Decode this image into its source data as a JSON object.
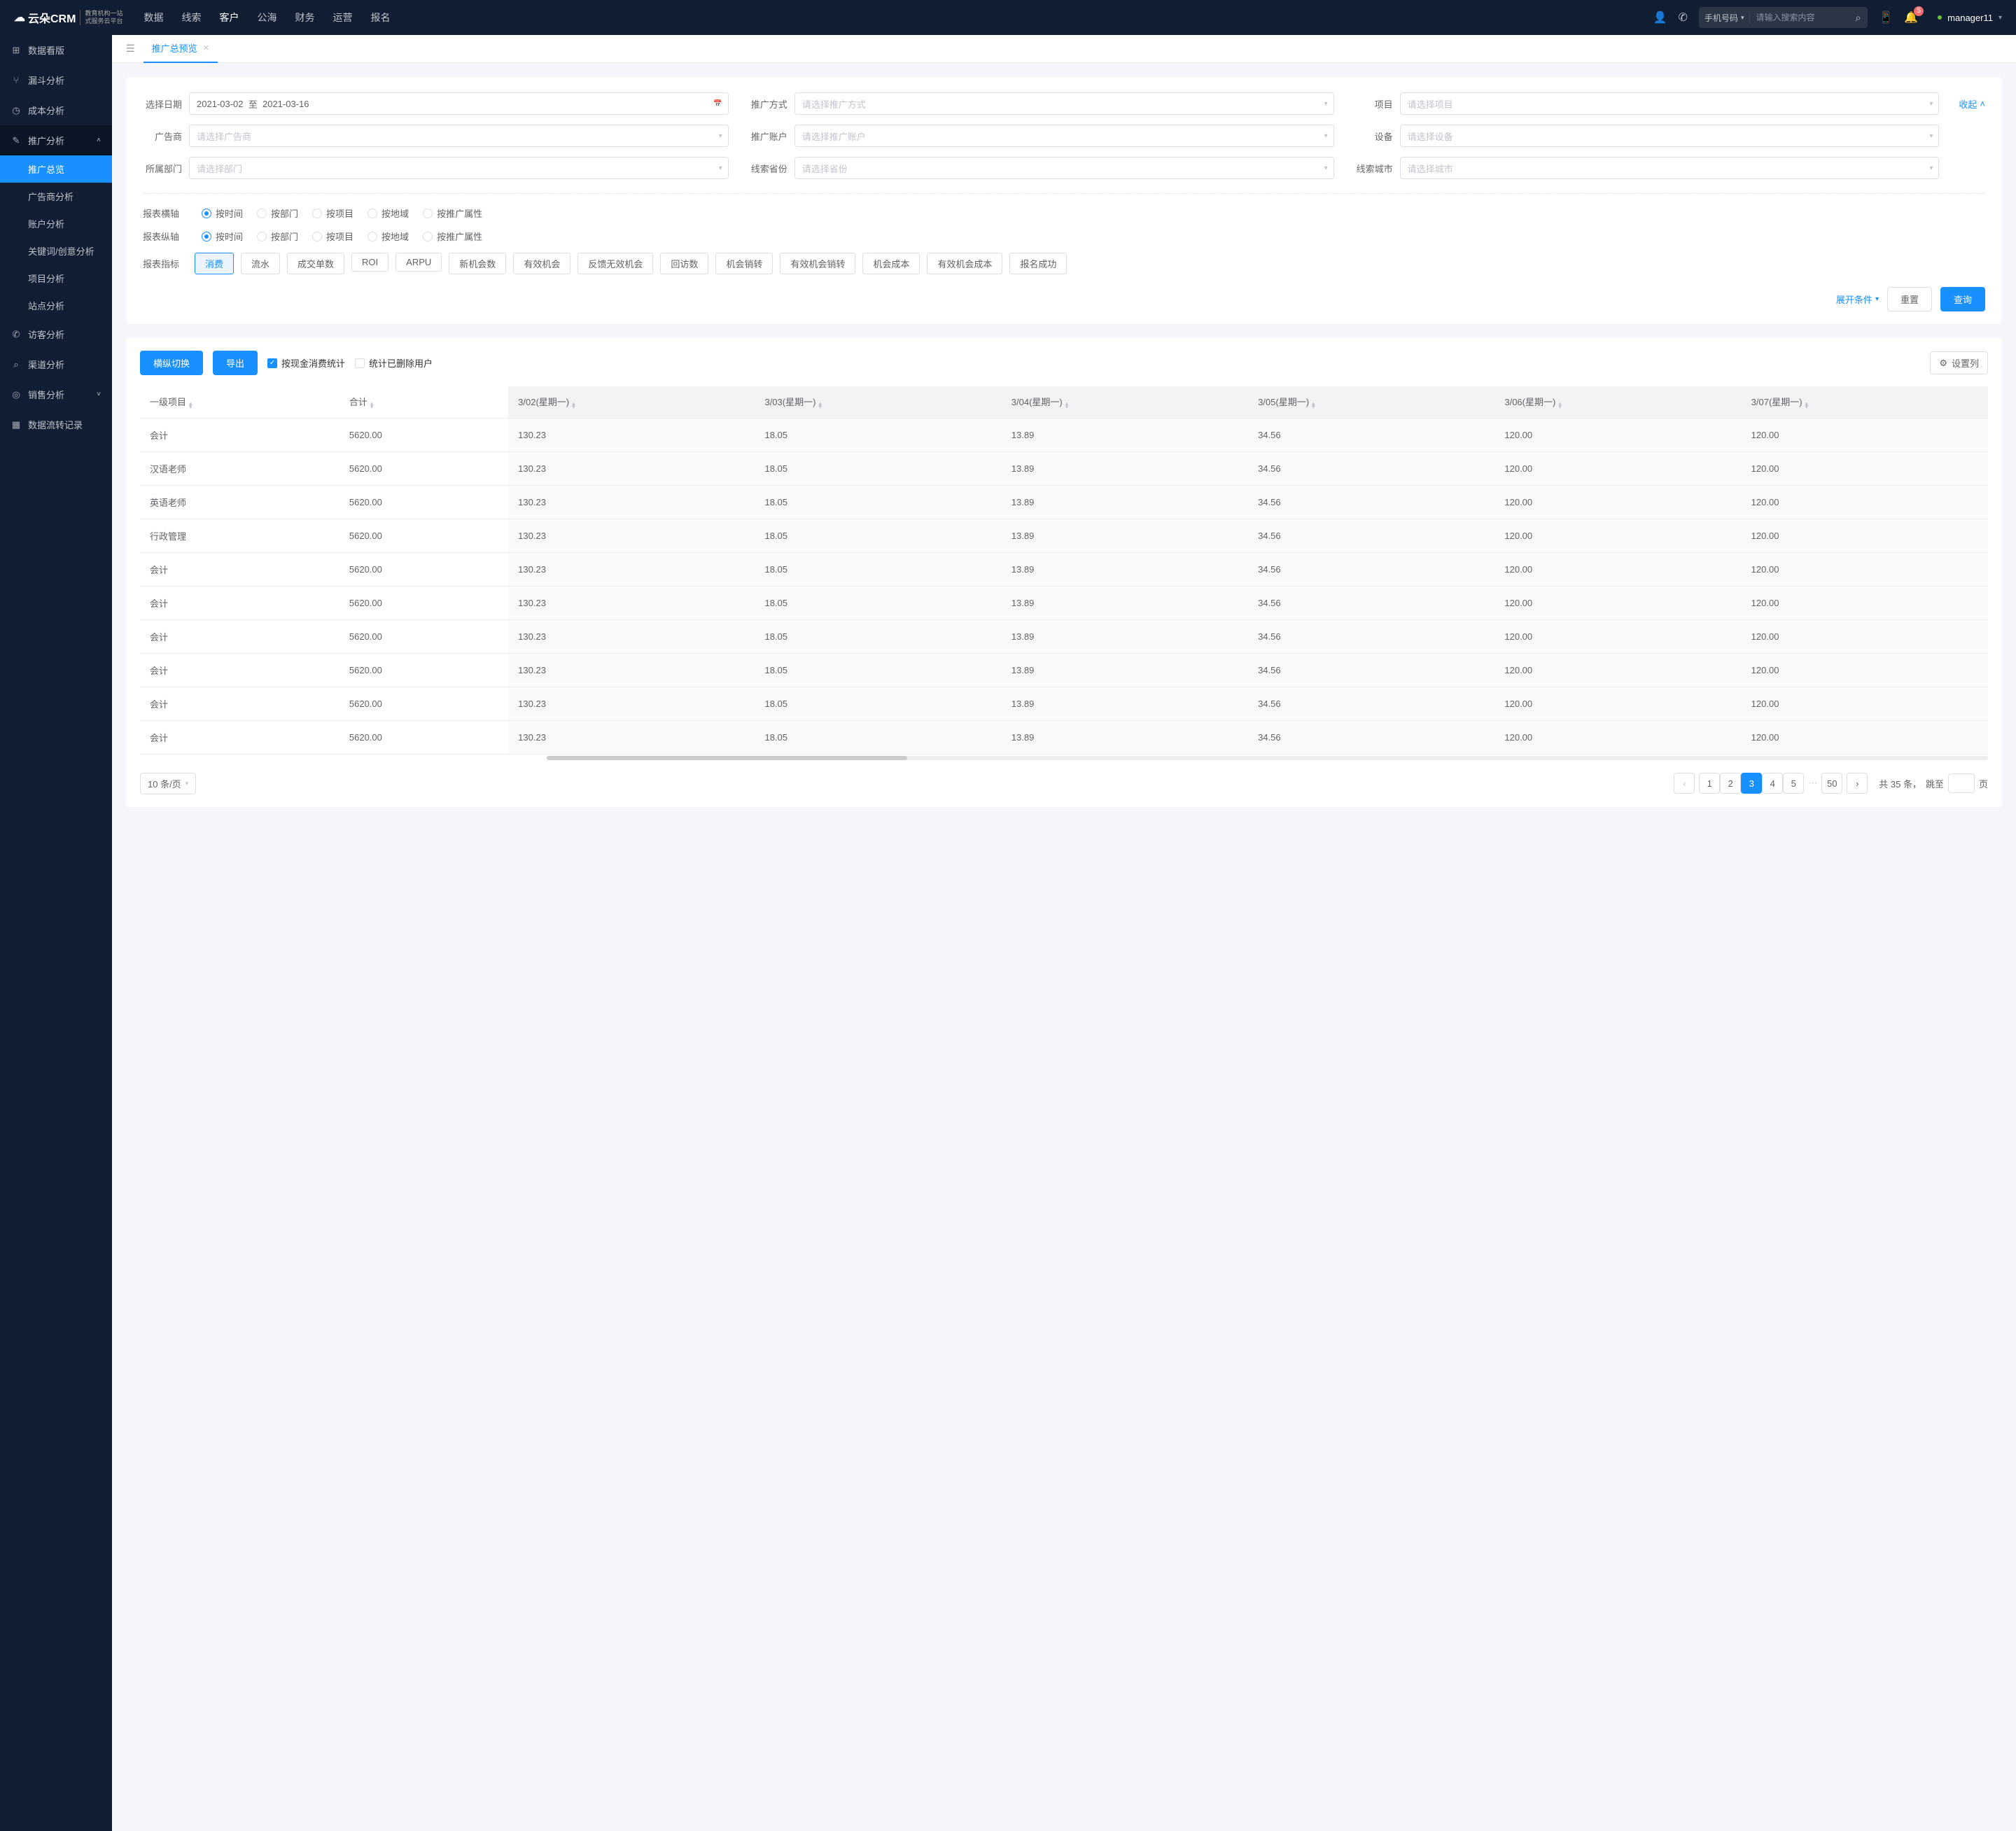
{
  "brand": {
    "name": "云朵CRM",
    "url": "www.yunduocrm.com",
    "tag1": "教育机构一站",
    "tag2": "式服务云平台"
  },
  "topnav": [
    "数据",
    "线索",
    "客户",
    "公海",
    "财务",
    "运营",
    "报名"
  ],
  "topnav_active": 2,
  "search": {
    "type": "手机号码",
    "placeholder": "请输入搜索内容"
  },
  "notif_count": "5",
  "user": "manager11",
  "sidebar": {
    "items": [
      {
        "icon": "⊞",
        "label": "数据看版"
      },
      {
        "icon": "⑂",
        "label": "漏斗分析"
      },
      {
        "icon": "◷",
        "label": "成本分析"
      },
      {
        "icon": "✎",
        "label": "推广分析",
        "expanded": true,
        "children": [
          "推广总览",
          "广告商分析",
          "账户分析",
          "关键词/创意分析",
          "项目分析",
          "站点分析"
        ],
        "active_child": 0
      },
      {
        "icon": "✆",
        "label": "访客分析"
      },
      {
        "icon": "⌕",
        "label": "渠道分析"
      },
      {
        "icon": "◎",
        "label": "销售分析",
        "chev": true
      },
      {
        "icon": "▦",
        "label": "数据流转记录"
      }
    ]
  },
  "tab": {
    "title": "推广总预览"
  },
  "filters": {
    "date_label": "选择日期",
    "date_from": "2021-03-02",
    "date_sep": "至",
    "date_to": "2021-03-16",
    "promo_method_label": "推广方式",
    "promo_method_ph": "请选择推广方式",
    "project_label": "项目",
    "project_ph": "请选择项目",
    "collapse": "收起",
    "advertiser_label": "广告商",
    "advertiser_ph": "请选择广告商",
    "account_label": "推广账户",
    "account_ph": "请选择推广账户",
    "device_label": "设备",
    "device_ph": "请选择设备",
    "dept_label": "所属部门",
    "dept_ph": "请选择部门",
    "province_label": "线索省份",
    "province_ph": "请选择省份",
    "city_label": "线索城市",
    "city_ph": "请选择城市"
  },
  "axis": {
    "x_label": "报表横轴",
    "y_label": "报表纵轴",
    "options": [
      "按时间",
      "按部门",
      "按项目",
      "按地域",
      "按推广属性"
    ],
    "x_selected": 0,
    "y_selected": 0
  },
  "metrics": {
    "label": "报表指标",
    "options": [
      "消费",
      "流水",
      "成交单数",
      "ROI",
      "ARPU",
      "新机会数",
      "有效机会",
      "反馈无效机会",
      "回访数",
      "机会销转",
      "有效机会销转",
      "机会成本",
      "有效机会成本",
      "报名成功"
    ],
    "selected": 0
  },
  "actions": {
    "expand": "展开条件",
    "reset": "重置",
    "query": "查询"
  },
  "tools": {
    "switch": "横纵切换",
    "export": "导出",
    "cash_cb": "按现金消费统计",
    "deleted_cb": "统计已删除用户",
    "cols": "设置列"
  },
  "table": {
    "headers": [
      "一级项目",
      "合计",
      "3/02(星期一)",
      "3/03(星期一)",
      "3/04(星期一)",
      "3/05(星期一)",
      "3/06(星期一)",
      "3/07(星期一)"
    ],
    "rows": [
      [
        "会计",
        "5620.00",
        "130.23",
        "18.05",
        "13.89",
        "34.56",
        "120.00",
        "120.00"
      ],
      [
        "汉语老师",
        "5620.00",
        "130.23",
        "18.05",
        "13.89",
        "34.56",
        "120.00",
        "120.00"
      ],
      [
        "英语老师",
        "5620.00",
        "130.23",
        "18.05",
        "13.89",
        "34.56",
        "120.00",
        "120.00"
      ],
      [
        "行政管理",
        "5620.00",
        "130.23",
        "18.05",
        "13.89",
        "34.56",
        "120.00",
        "120.00"
      ],
      [
        "会计",
        "5620.00",
        "130.23",
        "18.05",
        "13.89",
        "34.56",
        "120.00",
        "120.00"
      ],
      [
        "会计",
        "5620.00",
        "130.23",
        "18.05",
        "13.89",
        "34.56",
        "120.00",
        "120.00"
      ],
      [
        "会计",
        "5620.00",
        "130.23",
        "18.05",
        "13.89",
        "34.56",
        "120.00",
        "120.00"
      ],
      [
        "会计",
        "5620.00",
        "130.23",
        "18.05",
        "13.89",
        "34.56",
        "120.00",
        "120.00"
      ],
      [
        "会计",
        "5620.00",
        "130.23",
        "18.05",
        "13.89",
        "34.56",
        "120.00",
        "120.00"
      ],
      [
        "会计",
        "5620.00",
        "130.23",
        "18.05",
        "13.89",
        "34.56",
        "120.00",
        "120.00"
      ]
    ]
  },
  "pager": {
    "size": "10 条/页",
    "pages": [
      "1",
      "2",
      "3",
      "4",
      "5"
    ],
    "last": "50",
    "active": 2,
    "total_prefix": "共 ",
    "total": "35",
    "total_suffix": " 条，",
    "jump": "跳至",
    "page_unit": "页"
  }
}
